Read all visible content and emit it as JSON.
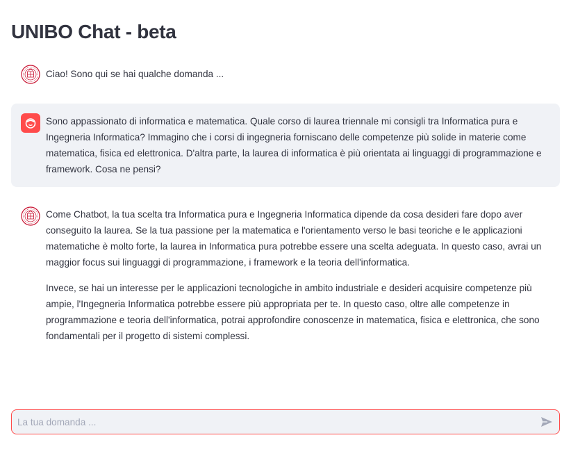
{
  "app": {
    "title": "UNIBO Chat - beta"
  },
  "messages": [
    {
      "role": "assistant",
      "avatar": "unibo-seal-icon",
      "paragraphs": [
        "Ciao! Sono qui se hai qualche domanda ..."
      ]
    },
    {
      "role": "user",
      "avatar": "user-face-icon",
      "paragraphs": [
        "Sono appassionato di informatica e matematica. Quale corso di laurea triennale mi consigli tra Informatica pura e Ingegneria Informatica? Immagino che i corsi di ingegneria forniscano delle competenze più solide in materie come matematica, fisica ed elettronica. D'altra parte, la laurea di informatica è più orientata ai linguaggi di programmazione e framework. Cosa ne pensi?"
      ]
    },
    {
      "role": "assistant",
      "avatar": "unibo-seal-icon",
      "paragraphs": [
        "Come Chatbot, la tua scelta tra Informatica pura e Ingegneria Informatica dipende da cosa desideri fare dopo aver conseguito la laurea. Se la tua passione per la matematica e l'orientamento verso le basi teoriche e le applicazioni matematiche è molto forte, la laurea in Informatica pura potrebbe essere una scelta adeguata. In questo caso, avrai un maggior focus sui linguaggi di programmazione, i framework e la teoria dell'informatica.",
        "Invece, se hai un interesse per le applicazioni tecnologiche in ambito industriale e desideri acquisire competenze più ampie, l'Ingegneria Informatica potrebbe essere più appropriata per te. In questo caso, oltre alle competenze in programmazione e teoria dell'informatica, potrai approfondire conoscenze in matematica, fisica e elettronica, che sono fondamentali per il progetto di sistemi complessi."
      ]
    }
  ],
  "input": {
    "placeholder": "La tua domanda ...",
    "value": "",
    "send_icon": "send-icon"
  },
  "colors": {
    "accent": "#ff4b4b",
    "user_bg": "#f0f2f6",
    "text": "#31333f",
    "seal": "#c8102e"
  }
}
